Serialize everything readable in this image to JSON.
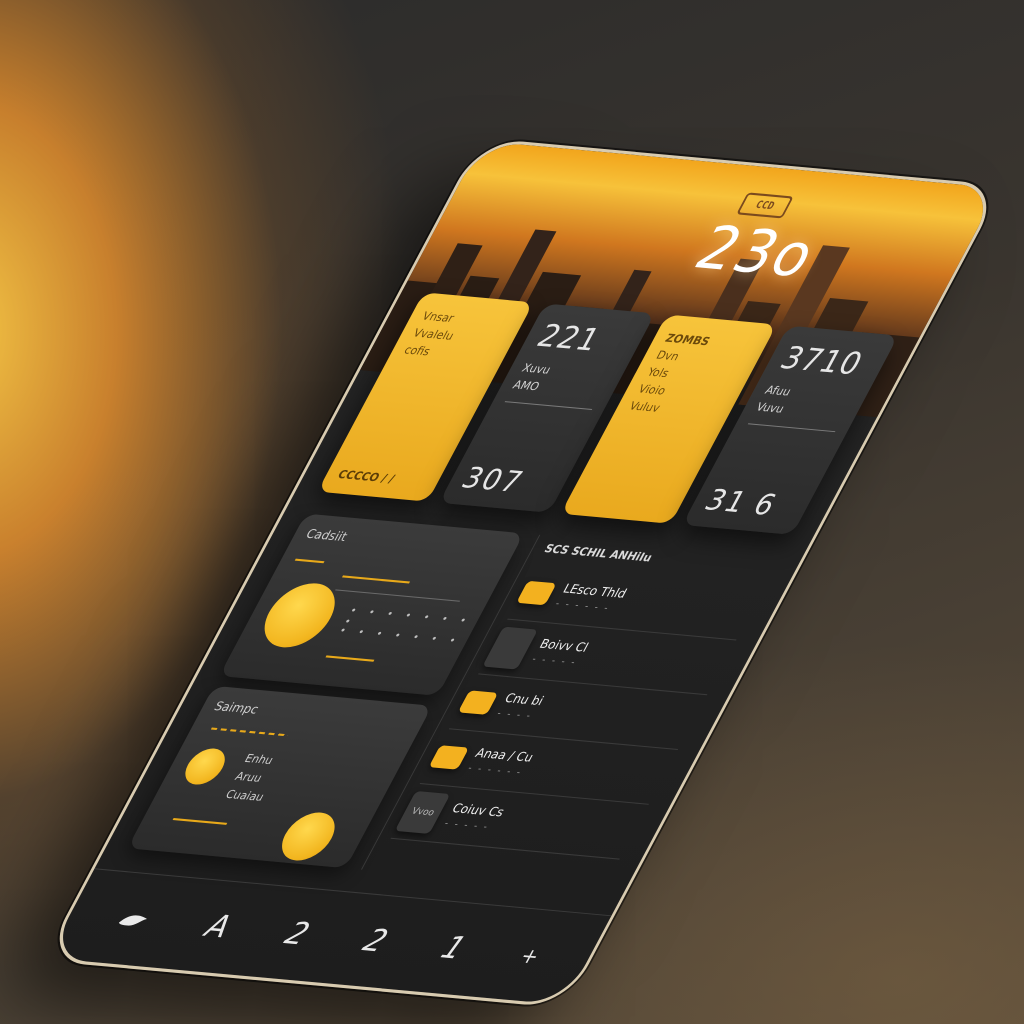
{
  "header": {
    "status_badge": "CCD",
    "hero_value": "23o"
  },
  "cards": [
    {
      "type": "yellow",
      "lines": [
        "Vnsar",
        "Vvalelu",
        "cofis"
      ],
      "foot": "CCCCO / /"
    },
    {
      "type": "dark",
      "big": "221",
      "lines": [
        "Xuvu",
        "AMO"
      ],
      "big_bottom": "307"
    },
    {
      "type": "yellow",
      "lines": [
        "ZOMBS",
        "Dvn",
        "Yols",
        "Vioio",
        "Vuluv"
      ]
    },
    {
      "type": "dark",
      "big": "3710",
      "lines": [
        "Afuu",
        "Vuvu"
      ],
      "big_bottom": "31 6"
    }
  ],
  "panels": [
    {
      "title": "Cadsiit"
    },
    {
      "title": "Saimpc",
      "text": [
        "Enhu",
        "Aruu",
        "Cuaiau"
      ]
    }
  ],
  "list": {
    "header": "SCS SCHIL ANHiIu",
    "items": [
      {
        "chip": "yellow",
        "title": "LEsco Thld",
        "sub": "- - - - - -"
      },
      {
        "chip": "dark",
        "title": "Boivv Cl",
        "sub": "- - - - -"
      },
      {
        "chip": "yellow",
        "title": "Cnu bi",
        "sub": "- - - -"
      },
      {
        "chip": "yellow",
        "title": "Anaa / Cu",
        "sub": "- - - - - -"
      },
      {
        "chip": "dark",
        "chip_text": "Vvoo",
        "title": "Coiuv Cs",
        "sub": "- - - - -"
      }
    ]
  },
  "nav": {
    "items": [
      "A",
      "2",
      "2",
      "1"
    ],
    "plus": "+"
  },
  "colors": {
    "accent": "#f3b11f",
    "background": "#1f1f1f",
    "card_dark": "#333333"
  }
}
